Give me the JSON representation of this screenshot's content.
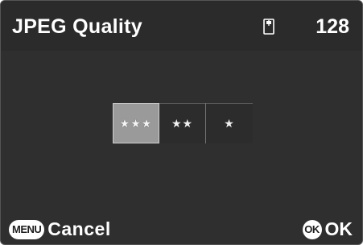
{
  "header": {
    "title": "JPEG Quality",
    "card_icon": "sd-card-icon",
    "shots_remaining": "128"
  },
  "quality_options": [
    {
      "label": "★★★",
      "selected": true
    },
    {
      "label": "★★",
      "selected": false
    },
    {
      "label": "★",
      "selected": false
    }
  ],
  "footer": {
    "menu_badge": "MENU",
    "cancel_label": "Cancel",
    "ok_badge": "OK",
    "ok_label": "OK"
  },
  "colors": {
    "background": "#2f2f2f",
    "selected": "#9a9a9a",
    "text": "#ffffff"
  }
}
